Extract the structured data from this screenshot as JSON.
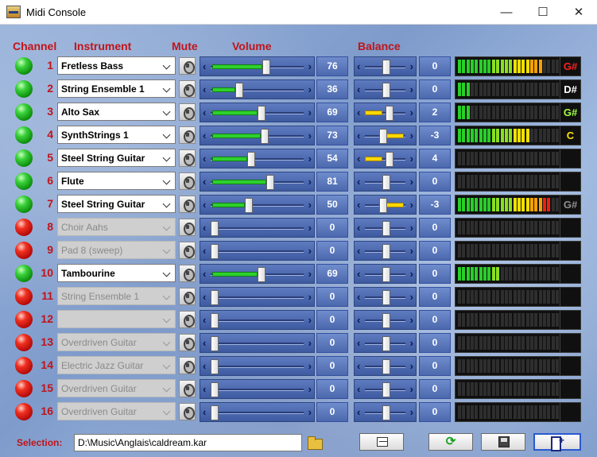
{
  "window": {
    "title": "Midi Console",
    "minimize": "—",
    "maximize": "☐",
    "close": "✕"
  },
  "headers": {
    "channel": "Channel",
    "instrument": "Instrument",
    "mute": "Mute",
    "volume": "Volume",
    "balance": "Balance"
  },
  "colors": {
    "accent_red": "#c0141a",
    "led_on": "#2ed02e",
    "led_off": "#e02010",
    "volume_fill": "#2ed02e",
    "balance_fill": "#ffd800",
    "panel_blue": "#8faad4"
  },
  "channels": [
    {
      "num": "1",
      "on": true,
      "instrument": "Fretless Bass",
      "volume": 76,
      "volume_label": "76",
      "balance": 0,
      "balance_label": "0",
      "level": 20,
      "note": "G#",
      "note_color": "#ff2020"
    },
    {
      "num": "2",
      "on": true,
      "instrument": "String Ensemble 1",
      "volume": 36,
      "volume_label": "36",
      "balance": 0,
      "balance_label": "0",
      "level": 3,
      "note": "D#",
      "note_color": "#ffffff"
    },
    {
      "num": "3",
      "on": true,
      "instrument": "Alto Sax",
      "volume": 69,
      "volume_label": "69",
      "balance": 2,
      "balance_label": "2",
      "level": 3,
      "note": "G#",
      "note_color": "#a0ff40"
    },
    {
      "num": "4",
      "on": true,
      "instrument": "SynthStrings 1",
      "volume": 73,
      "volume_label": "73",
      "balance": -3,
      "balance_label": "-3",
      "level": 17,
      "note": "C",
      "note_color": "#ffe000"
    },
    {
      "num": "5",
      "on": true,
      "instrument": "Steel String Guitar",
      "volume": 54,
      "volume_label": "54",
      "balance": 4,
      "balance_label": "4",
      "level": 0,
      "note": "",
      "note_color": "#ffffff"
    },
    {
      "num": "6",
      "on": true,
      "instrument": "Flute",
      "volume": 81,
      "volume_label": "81",
      "balance": 0,
      "balance_label": "0",
      "level": 0,
      "note": "",
      "note_color": "#ffffff"
    },
    {
      "num": "7",
      "on": true,
      "instrument": "Steel String Guitar",
      "volume": 50,
      "volume_label": "50",
      "balance": -3,
      "balance_label": "-3",
      "level": 22,
      "note": "G#",
      "note_color": "#909090"
    },
    {
      "num": "8",
      "on": false,
      "instrument": "Choir Aahs",
      "volume": 0,
      "volume_label": "0",
      "balance": 0,
      "balance_label": "0",
      "level": 0,
      "note": "",
      "note_color": "#ffffff"
    },
    {
      "num": "9",
      "on": false,
      "instrument": "Pad 8 (sweep)",
      "volume": 0,
      "volume_label": "0",
      "balance": 0,
      "balance_label": "0",
      "level": 0,
      "note": "",
      "note_color": "#ffffff"
    },
    {
      "num": "10",
      "on": true,
      "instrument": "Tambourine",
      "volume": 69,
      "volume_label": "69",
      "balance": 0,
      "balance_label": "0",
      "level": 10,
      "note": "",
      "note_color": "#ffffff"
    },
    {
      "num": "11",
      "on": false,
      "instrument": "String Ensemble 1",
      "volume": 0,
      "volume_label": "0",
      "balance": 0,
      "balance_label": "0",
      "level": 0,
      "note": "",
      "note_color": "#ffffff"
    },
    {
      "num": "12",
      "on": false,
      "instrument": "",
      "volume": 0,
      "volume_label": "0",
      "balance": 0,
      "balance_label": "0",
      "level": 0,
      "note": "",
      "note_color": "#ffffff"
    },
    {
      "num": "13",
      "on": false,
      "instrument": "Overdriven Guitar",
      "volume": 0,
      "volume_label": "0",
      "balance": 0,
      "balance_label": "0",
      "level": 0,
      "note": "",
      "note_color": "#ffffff"
    },
    {
      "num": "14",
      "on": false,
      "instrument": "Electric Jazz Guitar",
      "volume": 0,
      "volume_label": "0",
      "balance": 0,
      "balance_label": "0",
      "level": 0,
      "note": "",
      "note_color": "#ffffff"
    },
    {
      "num": "15",
      "on": false,
      "instrument": "Overdriven Guitar",
      "volume": 0,
      "volume_label": "0",
      "balance": 0,
      "balance_label": "0",
      "level": 0,
      "note": "",
      "note_color": "#ffffff"
    },
    {
      "num": "16",
      "on": false,
      "instrument": "Overdriven Guitar",
      "volume": 0,
      "volume_label": "0",
      "balance": 0,
      "balance_label": "0",
      "level": 0,
      "note": "",
      "note_color": "#ffffff"
    }
  ],
  "selection": {
    "label": "Selection:",
    "path": "D:\\Music\\Anglais\\caldream.kar"
  },
  "buttons": [
    {
      "name": "waveform-button",
      "icon": "waveform-icon"
    },
    {
      "name": "refresh-button",
      "icon": "refresh-icon"
    },
    {
      "name": "save-button",
      "icon": "floppy-disk-icon"
    },
    {
      "name": "exit-button",
      "icon": "exit-door-icon"
    }
  ]
}
